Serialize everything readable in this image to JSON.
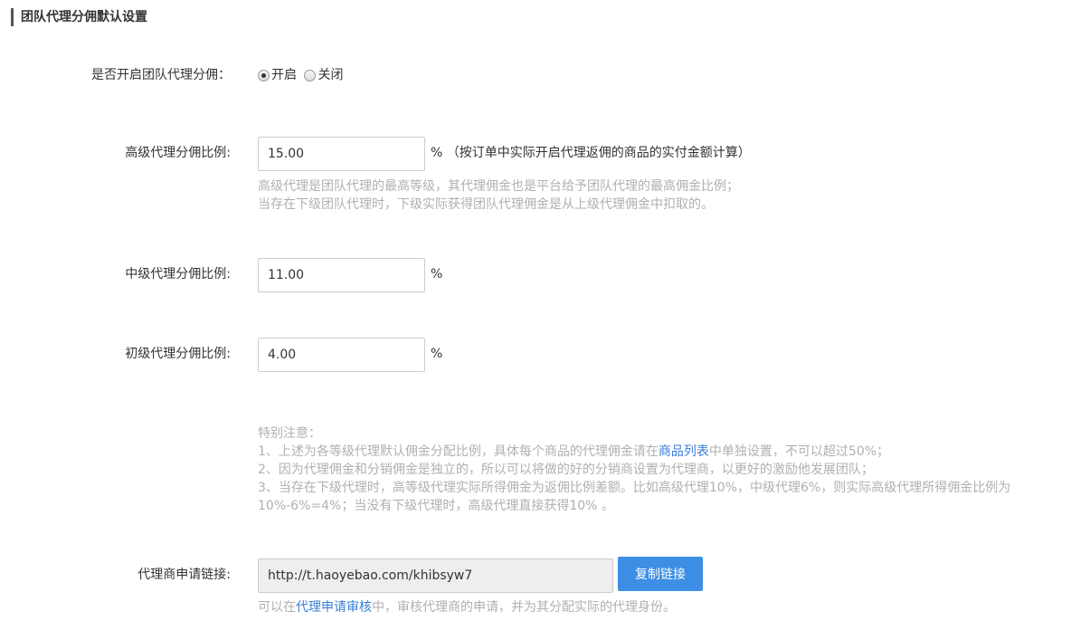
{
  "section_title": "团队代理分佣默认设置",
  "enable": {
    "label": "是否开启团队代理分佣：",
    "options": [
      {
        "label": "开启",
        "checked": true
      },
      {
        "label": "关闭",
        "checked": false
      }
    ]
  },
  "senior": {
    "label": "高级代理分佣比例:",
    "value": "15.00",
    "unit": "%",
    "unit_note": "（按订单中实际开启代理返佣的商品的实付金额计算）",
    "hint_line1": "高级代理是团队代理的最高等级，其代理佣金也是平台给予团队代理的最高佣金比例；",
    "hint_line2": "当存在下级团队代理时，下级实际获得团队代理佣金是从上级代理佣金中扣取的。"
  },
  "middle": {
    "label": "中级代理分佣比例:",
    "value": "11.00",
    "unit": "%"
  },
  "junior": {
    "label": "初级代理分佣比例:",
    "value": "4.00",
    "unit": "%"
  },
  "notice": {
    "title": "特别注意：",
    "line1_before": "1、上述为各等级代理默认佣金分配比例，具体每个商品的代理佣金请在",
    "line1_link": "商品列表",
    "line1_after": "中单独设置，不可以超过50%；",
    "line2": "2、因为代理佣金和分销佣金是独立的，所以可以将做的好的分销商设置为代理商，以更好的激励他发展团队；",
    "line3": "3、当存在下级代理时，高等级代理实际所得佣金为返佣比例差额。比如高级代理10%，中级代理6%，则实际高级代理所得佣金比例为",
    "line4": "10%-6%=4%；当没有下级代理时，高级代理直接获得10% 。"
  },
  "apply_link": {
    "label": "代理商申请链接:",
    "value": "http://t.haoyebao.com/khibsyw7",
    "copy_button": "复制链接",
    "hint_before": "可以在",
    "hint_link": "代理申请审核",
    "hint_after": "中，审核代理商的申请，并为其分配实际的代理身份。"
  }
}
